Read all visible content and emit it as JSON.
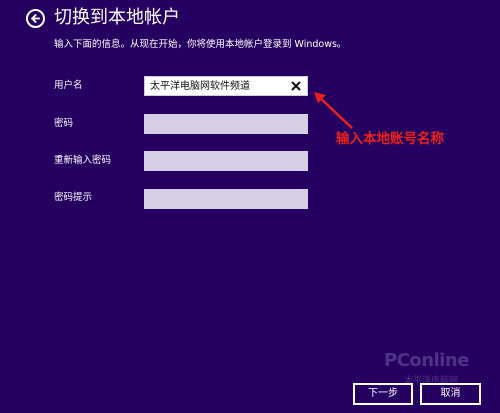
{
  "header": {
    "title": "切换到本地帐户",
    "subtitle": "输入下面的信息。从现在开始，你将使用本地帐户登录到 Windows。"
  },
  "form": {
    "username_label": "用户名",
    "username_value": "太平洋电脑网软件频道",
    "password_label": "密码",
    "password_value": "",
    "confirm_label": "重新输入密码",
    "confirm_value": "",
    "hint_label": "密码提示",
    "hint_value": ""
  },
  "annotation": {
    "text": "输入本地账号名称",
    "color": "#e8211b"
  },
  "watermark": {
    "brand": "PConline",
    "sub": "太平洋电脑网"
  },
  "buttons": {
    "next_label": "下一步",
    "cancel_label": "取消"
  },
  "colors": {
    "background": "#250060",
    "field_inactive": "#d6cfe6",
    "field_active": "#ffffff"
  },
  "icons": {
    "back": "back-arrow-icon",
    "clear": "clear-x-icon"
  }
}
